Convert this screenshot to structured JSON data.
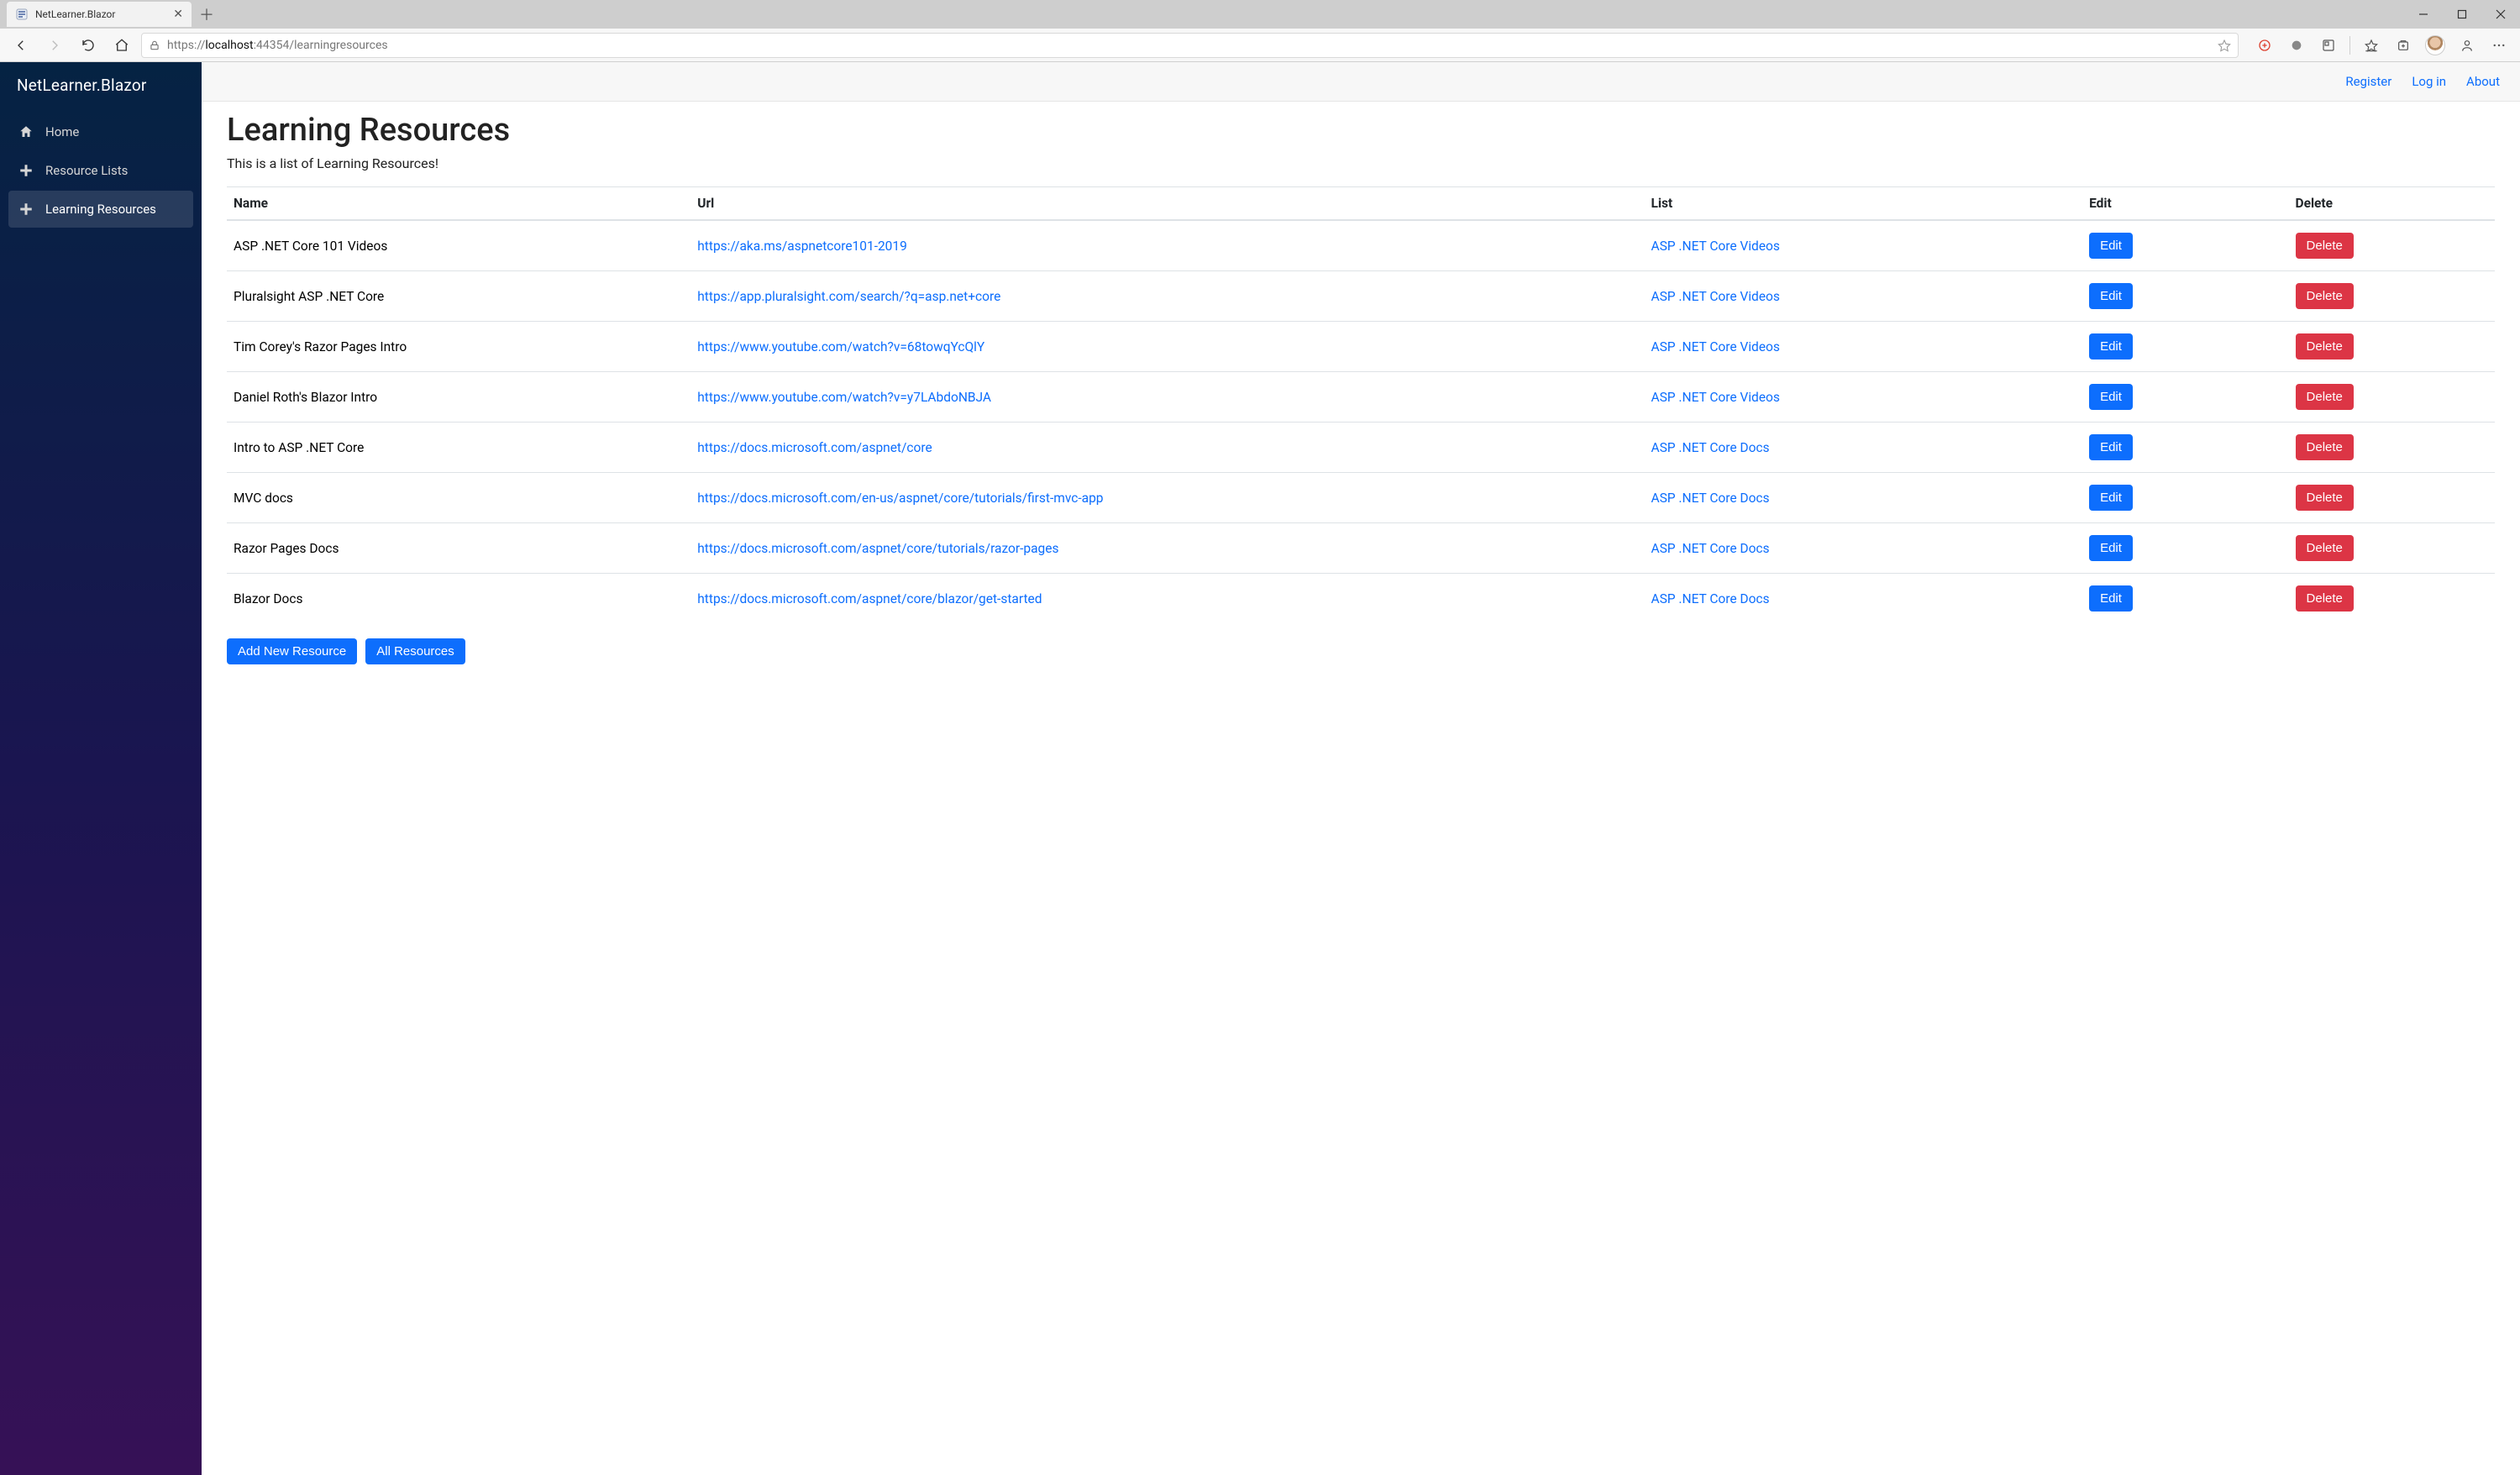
{
  "browser": {
    "tab_title": "NetLearner.Blazor",
    "url_scheme": "https://",
    "url_host": "localhost",
    "url_port_path": ":44354/learningresources"
  },
  "sidebar": {
    "brand": "NetLearner.Blazor",
    "items": [
      {
        "label": "Home",
        "icon": "home"
      },
      {
        "label": "Resource Lists",
        "icon": "plus"
      },
      {
        "label": "Learning Resources",
        "icon": "plus",
        "active": true
      }
    ]
  },
  "header_links": {
    "register": "Register",
    "login": "Log in",
    "about": "About"
  },
  "page": {
    "title": "Learning Resources",
    "subtitle": "This is a list of Learning Resources!"
  },
  "table": {
    "headers": {
      "name": "Name",
      "url": "Url",
      "list": "List",
      "edit": "Edit",
      "delete": "Delete"
    },
    "edit_label": "Edit",
    "delete_label": "Delete",
    "rows": [
      {
        "name": "ASP .NET Core 101 Videos",
        "url": "https://aka.ms/aspnetcore101-2019",
        "list": "ASP .NET Core Videos"
      },
      {
        "name": "Pluralsight ASP .NET Core",
        "url": "https://app.pluralsight.com/search/?q=asp.net+core",
        "list": "ASP .NET Core Videos"
      },
      {
        "name": "Tim Corey's Razor Pages Intro",
        "url": "https://www.youtube.com/watch?v=68towqYcQlY",
        "list": "ASP .NET Core Videos"
      },
      {
        "name": "Daniel Roth's Blazor Intro",
        "url": "https://www.youtube.com/watch?v=y7LAbdoNBJA",
        "list": "ASP .NET Core Videos"
      },
      {
        "name": "Intro to ASP .NET Core",
        "url": "https://docs.microsoft.com/aspnet/core",
        "list": "ASP .NET Core Docs"
      },
      {
        "name": "MVC docs",
        "url": "https://docs.microsoft.com/en-us/aspnet/core/tutorials/first-mvc-app",
        "list": "ASP .NET Core Docs"
      },
      {
        "name": "Razor Pages Docs",
        "url": "https://docs.microsoft.com/aspnet/core/tutorials/razor-pages",
        "list": "ASP .NET Core Docs"
      },
      {
        "name": "Blazor Docs",
        "url": "https://docs.microsoft.com/aspnet/core/blazor/get-started",
        "list": "ASP .NET Core Docs"
      }
    ]
  },
  "actions": {
    "add_new": "Add New Resource",
    "all_resources": "All Resources"
  }
}
